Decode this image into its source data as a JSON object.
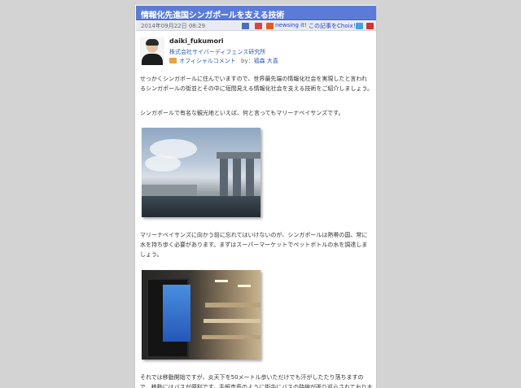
{
  "article": {
    "title": "情報化先進国シンガポールを支える技術",
    "date": "2014年09月22日 08:29",
    "actions": {
      "newsing_label": "newsing it!",
      "choix_label": "この記事をChoix！"
    },
    "author": {
      "name": "daiki_fukumori",
      "company": "株式会社サイバーディフェンス研究所",
      "comment_type": "オフィシャルコメント",
      "by_label": "by：",
      "by_name": "福森 大喜"
    },
    "paragraphs": [
      "せっかくシンガポールに住んでいますので、世界最先端の情報化社会を実現したと言われるシンガポールの街並とその中に垣間見える情報化社会を支える技術をご紹介しましょう。",
      "シンガポールで有名な観光地といえば、何と言ってもマリーナベイサンズです。",
      "マリーナベイサンズに向かう前に忘れてはいけないのが、シンガポールは熱帯の国、常に水を持ち歩く必要があります。まずはスーパーマーケットでペットボトルの水を調達しましょう。",
      "それでは移動開始ですが、炎天下を50メートル歩いただけでも汗がしたたり落ちますので、移動にはバスが便利です。手紙市長のように街中にバスの路線が張り巡らされており大"
    ]
  },
  "colors": {
    "title_bar": "#5b7bd8",
    "background": "#d3d3d3",
    "link": "#2a5db0"
  },
  "icons": [
    "bookmark-icon",
    "social-icon",
    "newsing-icon",
    "choix-icon",
    "share-icon",
    "pdf-icon"
  ]
}
